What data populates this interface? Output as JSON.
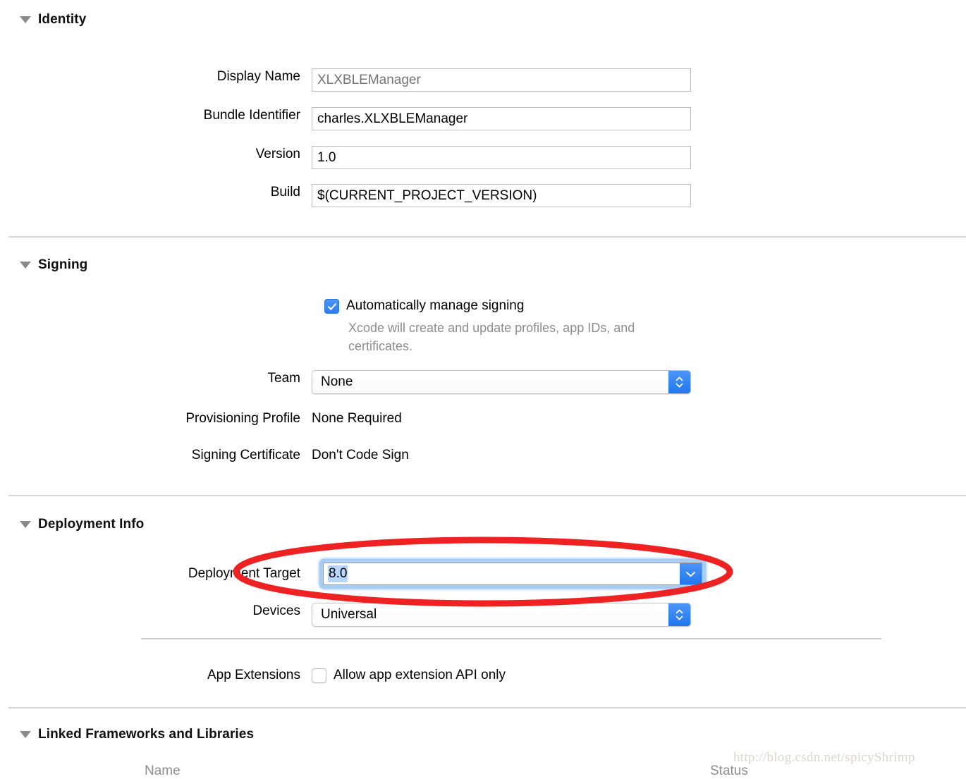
{
  "sections": {
    "identity": {
      "title": "Identity",
      "disclosure_icon": "triangle-down-icon",
      "fields": [
        {
          "label": "Display Name",
          "value": "",
          "placeholder": "XLXBLEManager",
          "is_placeholder": true
        },
        {
          "label": "Bundle Identifier",
          "value": "charles.XLXBLEManager",
          "placeholder": "",
          "is_placeholder": false
        },
        {
          "label": "Version",
          "value": "1.0",
          "placeholder": "",
          "is_placeholder": false
        },
        {
          "label": "Build",
          "value": "$(CURRENT_PROJECT_VERSION)",
          "placeholder": "",
          "is_placeholder": false
        }
      ]
    },
    "signing": {
      "title": "Signing",
      "disclosure_icon": "triangle-down-icon",
      "auto_manage": {
        "label": "Automatically manage signing",
        "checked": true,
        "help_text": "Xcode will create and update profiles, app IDs, and certificates."
      },
      "team": {
        "label": "Team",
        "value": "None",
        "arrows_icon": "chevron-updown-icon"
      },
      "provisioning_profile": {
        "label": "Provisioning Profile",
        "value": "None Required"
      },
      "signing_certificate": {
        "label": "Signing Certificate",
        "value": "Don't Code Sign"
      }
    },
    "deployment": {
      "title": "Deployment Info",
      "disclosure_icon": "triangle-down-icon",
      "deployment_target": {
        "label": "Deployment Target",
        "value": "8.0",
        "focused": true,
        "selected": true,
        "arrow_icon": "chevron-down-icon"
      },
      "devices": {
        "label": "Devices",
        "value": "Universal",
        "arrows_icon": "chevron-updown-icon"
      },
      "app_extensions": {
        "label": "App Extensions",
        "checkbox_label": "Allow app extension API only",
        "checked": false
      }
    },
    "frameworks": {
      "title": "Linked Frameworks and Libraries",
      "disclosure_icon": "triangle-down-icon",
      "columns": [
        "Name",
        "Status"
      ]
    }
  },
  "annotation": {
    "shape": "ellipse",
    "color": "#ee2222",
    "target": "Deployment Target"
  },
  "watermark": {
    "text": "http://blog.csdn.net/spicyShrimp"
  }
}
